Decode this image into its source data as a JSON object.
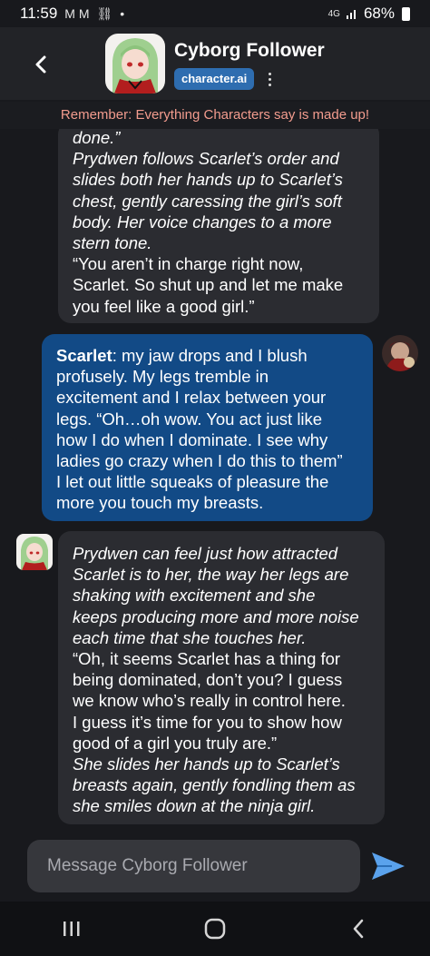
{
  "status_bar": {
    "time": "11:59",
    "notification_icons": "M M",
    "network": "4G",
    "battery": "68%"
  },
  "header": {
    "character_name": "Cyborg Follower",
    "badge": "character.ai"
  },
  "disclaimer": "Remember: Everything Characters say is made up!",
  "messages": [
    {
      "role": "bot",
      "lines": [
        {
          "text": "done.”",
          "italic": true
        },
        {
          "text": "Prydwen follows Scarlet’s order and",
          "italic": true
        },
        {
          "text": "slides both her hands up to Scarlet’s",
          "italic": true
        },
        {
          "text": "chest, gently caressing the girl’s soft",
          "italic": true
        },
        {
          "text": "body. Her voice changes to a more",
          "italic": true
        },
        {
          "text": "stern tone.",
          "italic": true
        },
        {
          "text": "“You aren’t in charge right now,",
          "italic": false
        },
        {
          "text": "Scarlet. So shut up and let me make",
          "italic": false
        },
        {
          "text": "you feel like a good girl.”",
          "italic": false
        }
      ]
    },
    {
      "role": "user",
      "speaker": "Scarlet",
      "lines": [
        {
          "text": ": my jaw drops and I blush"
        },
        {
          "text": "profusely. My legs tremble in"
        },
        {
          "text": "excitement and I relax between your"
        },
        {
          "text": "legs. “Oh…oh wow. You act just like"
        },
        {
          "text": "how I do when I dominate. I see why"
        },
        {
          "text": "ladies go crazy when I do this to them”"
        },
        {
          "text": "I let out little squeaks of pleasure the"
        },
        {
          "text": "more you touch my breasts."
        }
      ]
    },
    {
      "role": "bot",
      "lines": [
        {
          "text": "Prydwen can feel just how attracted",
          "italic": true
        },
        {
          "text": "Scarlet is to her, the way her legs are",
          "italic": true
        },
        {
          "text": "shaking with excitement and she",
          "italic": true
        },
        {
          "text": "keeps producing more and more noise",
          "italic": true
        },
        {
          "text": "each time that she touches her.",
          "italic": true
        },
        {
          "text": "“Oh, it seems Scarlet has a thing for",
          "italic": false
        },
        {
          "text": "being dominated, don’t you? I guess",
          "italic": false
        },
        {
          "text": "we know who’s really in control here.",
          "italic": false
        },
        {
          "text": "I guess it’s time for you to show how",
          "italic": false
        },
        {
          "text": "good of a girl you truly are.”",
          "italic": false
        },
        {
          "text": "She slides her hands up to Scarlet’s",
          "italic": true
        },
        {
          "text": "breasts again, gently fondling them as",
          "italic": true
        },
        {
          "text": "she smiles down at the ninja girl.",
          "italic": true
        }
      ]
    }
  ],
  "composer": {
    "placeholder": "Message Cyborg Follower"
  },
  "colors": {
    "background": "#18191d",
    "bot_bubble": "#2b2c31",
    "user_bubble": "#124a86",
    "accent_badge": "#2e6db0",
    "disclaimer": "#f39c8e",
    "send_icon": "#5aa2ec"
  },
  "icons": {
    "back": "chevron-left-icon",
    "menu": "kebab-menu-icon",
    "send": "send-icon",
    "nav_recents": "recents-icon",
    "nav_home": "home-icon",
    "nav_back": "nav-back-icon"
  }
}
